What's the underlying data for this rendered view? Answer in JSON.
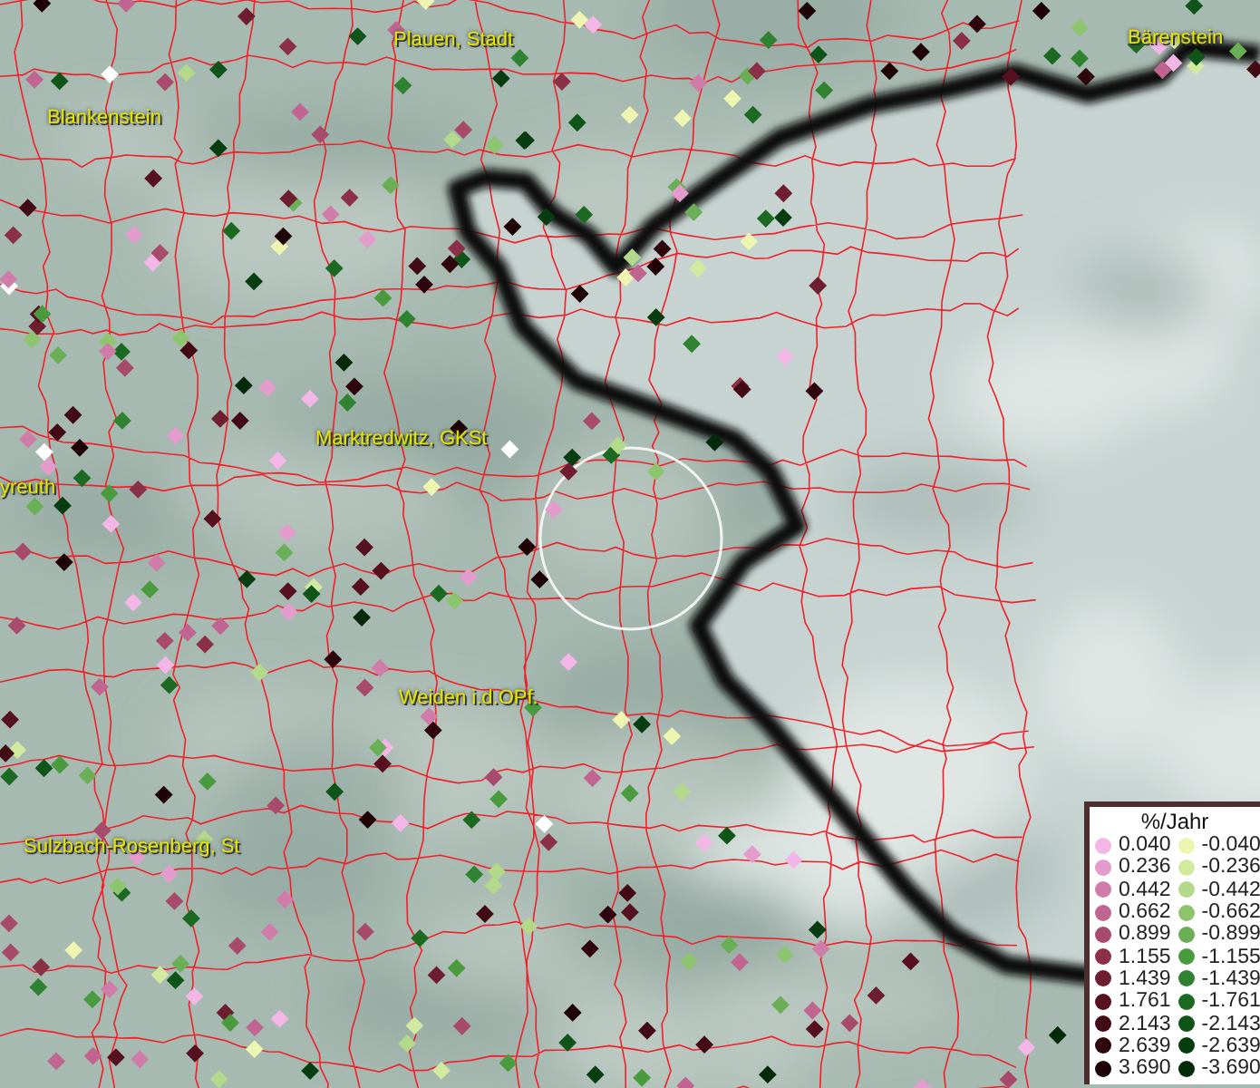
{
  "map": {
    "place_labels": [
      {
        "text": "Plauen, Stadt"
      },
      {
        "text": "Bärenstein"
      },
      {
        "text": "Blankenstein"
      },
      {
        "text": "Marktredwitz, GKSt"
      },
      {
        "text": "yreuth"
      },
      {
        "text": "Weiden i.d.OPf."
      },
      {
        "text": "Sulzbach-Rosenberg, St"
      }
    ]
  },
  "legend": {
    "title": "%/Jahr",
    "positive": [
      {
        "label": "0.040",
        "color": "#f4b6e6"
      },
      {
        "label": "0.236",
        "color": "#e39ccb"
      },
      {
        "label": "0.442",
        "color": "#d07ca8"
      },
      {
        "label": "0.662",
        "color": "#bf6590"
      },
      {
        "label": "0.899",
        "color": "#a84a6c"
      },
      {
        "label": "1.155",
        "color": "#8c3048"
      },
      {
        "label": "1.439",
        "color": "#6e1e30"
      },
      {
        "label": "1.761",
        "color": "#561020"
      },
      {
        "label": "2.143",
        "color": "#420a14"
      },
      {
        "label": "2.639",
        "color": "#2e050c"
      },
      {
        "label": "3.690",
        "color": "#1e0206"
      }
    ],
    "negative": [
      {
        "label": "-0.040",
        "color": "#eef5b0"
      },
      {
        "label": "-0.236",
        "color": "#d2eaa0"
      },
      {
        "label": "-0.442",
        "color": "#b3d98a"
      },
      {
        "label": "-0.662",
        "color": "#8dc46e"
      },
      {
        "label": "-0.899",
        "color": "#6aaf55"
      },
      {
        "label": "-1.155",
        "color": "#4a9a3e"
      },
      {
        "label": "-1.439",
        "color": "#2f8230"
      },
      {
        "label": "-1.761",
        "color": "#1c6a22"
      },
      {
        "label": "-2.143",
        "color": "#0f551a"
      },
      {
        "label": "-2.639",
        "color": "#063d10"
      },
      {
        "label": "-3.690",
        "color": "#022a08"
      }
    ]
  }
}
